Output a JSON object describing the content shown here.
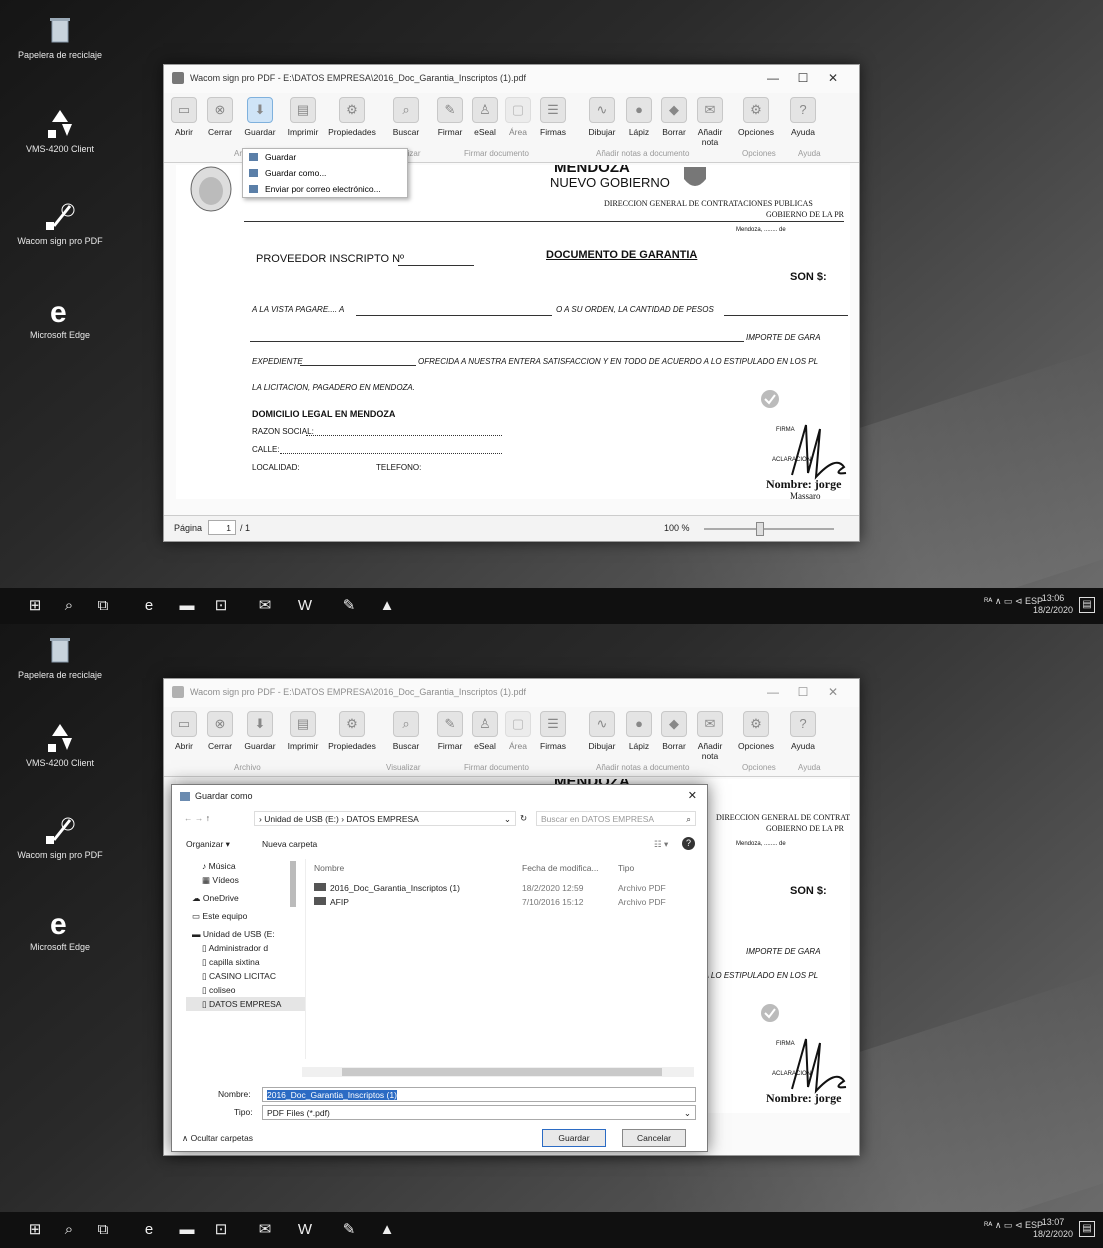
{
  "desktop": {
    "icons": [
      {
        "label": "Papelera de reciclaje",
        "icon": "recycle-bin"
      },
      {
        "label": "VMS-4200 Client",
        "icon": "vms-client"
      },
      {
        "label": "Wacom sign pro PDF",
        "icon": "wacom-pen"
      },
      {
        "label": "Microsoft Edge",
        "icon": "edge-e"
      }
    ]
  },
  "window": {
    "title": "Wacom sign pro PDF - E:\\DATOS EMPRESA\\2016_Doc_Garantia_Inscriptos (1).pdf",
    "ribbon": [
      "Abrir",
      "Cerrar",
      "Guardar",
      "Imprimir",
      "Propiedades",
      "Buscar",
      "Firmar",
      "eSeal",
      "Área",
      "Firmas",
      "Dibujar",
      "Lápiz",
      "Borrar",
      "Añadir nota",
      "Opciones",
      "Ayuda"
    ],
    "groups": [
      "Archivo",
      "Visualizar",
      "Firmar documento",
      "Añadir notas a documento",
      "Opciones",
      "Ayuda"
    ],
    "page_label": "Página",
    "page_current": "1",
    "page_total": "/ 1",
    "zoom": "100 %"
  },
  "menu": {
    "items": [
      "Guardar",
      "Guardar como...",
      "Enviar por correo electrónico..."
    ]
  },
  "document": {
    "brand_top": "MENDOZA",
    "brand": "NUEVO GOBIERNO",
    "dg1": "DIRECCION GENERAL DE CONTRATACIONES PUBLICAS",
    "dg2": "GOBIERNO DE LA PR",
    "mendoza_de": "Mendoza, ........ de",
    "proveedor": "PROVEEDOR INSCRIPTO Nº",
    "titulo": "DOCUMENTO DE GARANTIA",
    "son": "SON $:",
    "vista": "A LA VISTA PAGARE.... A",
    "orden": "O A SU ORDEN, LA CANTIDAD DE PESOS",
    "importe": "IMPORTE   DE   GARA",
    "expediente": "EXPEDIENTE",
    "ofrecida": "OFRECIDA A NUESTRA ENTERA SATISFACCION Y EN TODO DE ACUERDO A LO ESTIPULADO EN LOS PL",
    "licitacion": "LA LICITACION, PAGADERO EN MENDOZA.",
    "domicilio": "DOMICILIO LEGAL EN MENDOZA",
    "razon": "RAZON SOCIAL:",
    "calle": "CALLE:",
    "localidad": "LOCALIDAD:",
    "telefono": "TELEFONO:",
    "firma": "FIRMA",
    "aclaracion": "ACLARACION",
    "nombre": "Nombre: jorge",
    "signer": "Massaro"
  },
  "dialog": {
    "title": "Guardar como",
    "path": [
      "Unidad de USB (E:)",
      "DATOS EMPRESA"
    ],
    "search_placeholder": "Buscar en DATOS EMPRESA",
    "organizar": "Organizar ▾",
    "nueva": "Nueva carpeta",
    "nav": [
      "Música",
      "Vídeos",
      "OneDrive",
      "Este equipo",
      "Unidad de USB (E:",
      "Administrador d",
      "capilla sixtina",
      "CASINO LICITAC",
      "coliseo",
      "DATOS EMPRESA"
    ],
    "columns": [
      "Nombre",
      "Fecha de modifica...",
      "Tipo"
    ],
    "files": [
      {
        "name": "2016_Doc_Garantia_Inscriptos (1)",
        "date": "18/2/2020 12:59",
        "type": "Archivo PDF"
      },
      {
        "name": "AFIP",
        "date": "7/10/2016 15:12",
        "type": "Archivo PDF"
      }
    ],
    "nombre_label": "Nombre:",
    "nombre_value": "2016_Doc_Garantia_Inscriptos (1)",
    "tipo_label": "Tipo:",
    "tipo_value": "PDF Files (*.pdf)",
    "ocultar": "∧ Ocultar carpetas",
    "guardar": "Guardar",
    "cancelar": "Cancelar"
  },
  "taskbar": {
    "lang": "ESP",
    "top": {
      "time": "13:06",
      "date": "18/2/2020"
    },
    "bottom": {
      "time": "13:07",
      "date": "18/2/2020"
    }
  }
}
